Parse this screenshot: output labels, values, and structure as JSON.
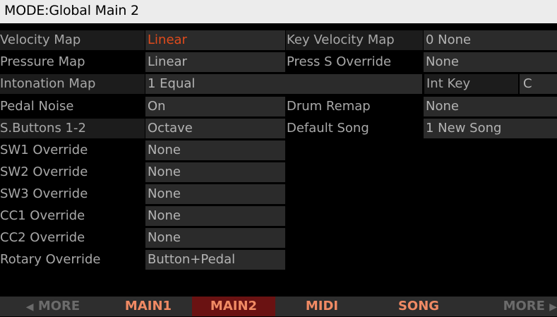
{
  "title": "MODE:Global Main 2",
  "left_params": [
    {
      "label": "Velocity Map",
      "value": "Linear"
    },
    {
      "label": "Pressure Map",
      "value": "Linear"
    },
    {
      "label": "Intonation Map",
      "value": "1 Equal"
    },
    {
      "label": "Pedal Noise",
      "value": "On"
    },
    {
      "label": "S.Buttons 1-2",
      "value": "Octave"
    },
    {
      "label": "SW1 Override",
      "value": "None"
    },
    {
      "label": "SW2 Override",
      "value": "None"
    },
    {
      "label": "SW3 Override",
      "value": "None"
    },
    {
      "label": "CC1 Override",
      "value": "None"
    },
    {
      "label": "CC2 Override",
      "value": "None"
    },
    {
      "label": "Rotary Override",
      "value": "Button+Pedal"
    }
  ],
  "right_params": {
    "key_velocity_map": {
      "label": "Key Velocity Map",
      "value": "0 None"
    },
    "press_s_override": {
      "label": "Press S Override",
      "value": "None"
    },
    "int_key": {
      "label": "Int Key",
      "value": "C"
    },
    "drum_remap": {
      "label": "Drum Remap",
      "value": "None"
    },
    "default_song": {
      "label": "Default Song",
      "value": "1 New Song"
    }
  },
  "softbuttons": {
    "more_left": "MORE",
    "main1": "MAIN1",
    "main2": "MAIN2",
    "midi": "MIDI",
    "song": "SONG",
    "more_right": "MORE"
  },
  "colors": {
    "selected_value": "#e04b1c",
    "active_tab_bg": "#6a1212",
    "tab_text": "#f08a64"
  }
}
